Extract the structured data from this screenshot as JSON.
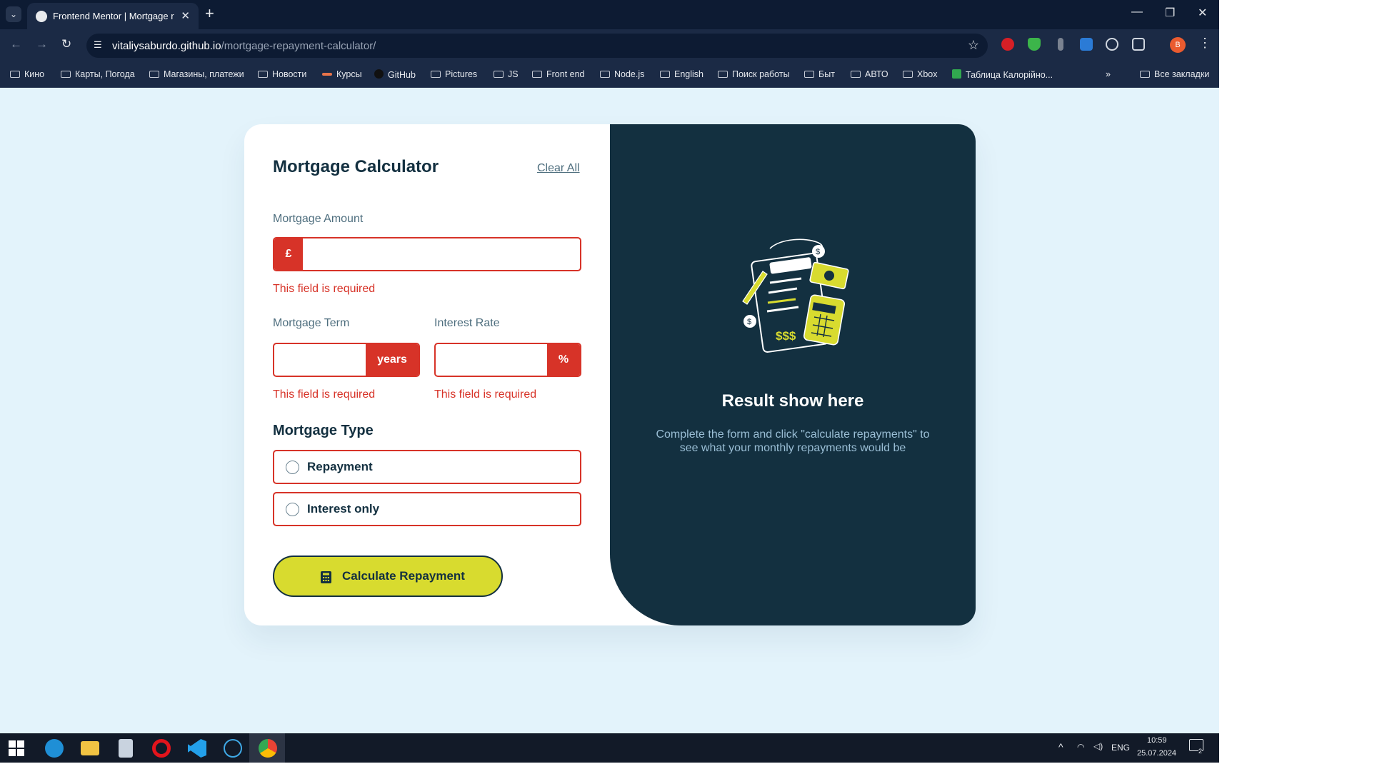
{
  "browser": {
    "tab_title": "Frontend Mentor | Mortgage re",
    "url_host": "vitaliysaburdo.github.io",
    "url_path": "/mortgage-repayment-calculator/",
    "profile_initial": "B",
    "bookmarks": [
      "Кино",
      "Карты, Погода",
      "Магазины, платежи",
      "Новости",
      "Курсы",
      "GitHub",
      "Pictures",
      "JS",
      "Front end",
      "Node.js",
      "English",
      "Поиск работы",
      "Быт",
      "АВТО",
      "Xbox",
      "Таблица Калорійно..."
    ],
    "all_bookmarks": "Все закладки"
  },
  "calculator": {
    "title": "Mortgage Calculator",
    "clear_all": "Clear All",
    "amount_label": "Mortgage Amount",
    "currency": "£",
    "amount_value": "",
    "term_label": "Mortgage Term",
    "term_unit": "years",
    "term_value": "",
    "rate_label": "Interest Rate",
    "rate_unit": "%",
    "rate_value": "",
    "error": "This field is required",
    "type_label": "Mortgage Type",
    "options": [
      "Repayment",
      "Interest only"
    ],
    "calc_button": "Calculate Repayment"
  },
  "results": {
    "title": "Result show here",
    "text": "Complete the form and click \"calculate repayments\" to see what your monthly repayments would be"
  },
  "taskbar": {
    "lang": "ENG",
    "time": "10:59",
    "date": "25.07.2024",
    "notifications": "2"
  },
  "colors": {
    "slate": "#133040",
    "lime": "#d8db2f",
    "red": "#d73328",
    "page_bg": "#e3f3fb"
  }
}
